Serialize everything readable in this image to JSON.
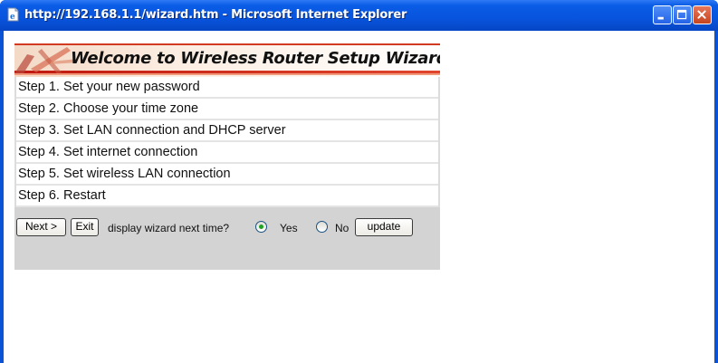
{
  "window": {
    "title": "http://192.168.1.1/wizard.htm - Microsoft Internet Explorer"
  },
  "wizard": {
    "banner_title": "Welcome to Wireless Router Setup Wizard",
    "steps": [
      "Step 1. Set your new password",
      "Step 2. Choose your time zone",
      "Step 3. Set LAN connection and DHCP server",
      "Step 4. Set internet connection",
      "Step 5. Set wireless LAN connection",
      "Step 6. Restart"
    ],
    "next_label": "Next >",
    "exit_label": "Exit",
    "question": "display wizard next time?",
    "yes_label": "Yes",
    "no_label": "No",
    "selected": "Yes",
    "update_label": "update"
  },
  "colors": {
    "titlebar": "#0854dd",
    "banner_accent": "#d62a1e",
    "panel": "#d3d3d3"
  },
  "icons": {
    "app": "ie-page-icon",
    "minimize": "minimize-icon",
    "maximize": "maximize-icon",
    "close": "close-icon"
  }
}
